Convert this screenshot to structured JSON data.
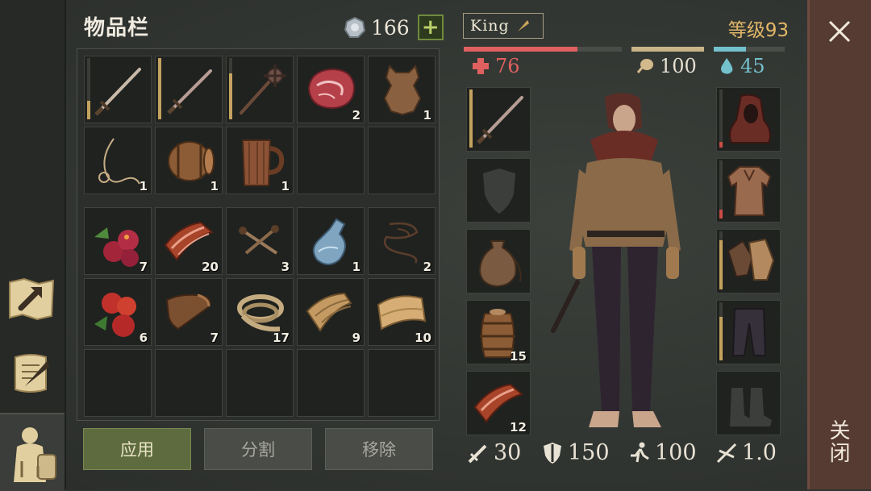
{
  "inventory": {
    "title": "物品栏",
    "coins": "166",
    "add_coins": "+"
  },
  "upper_slots": [
    {
      "icon": "longsword-icon",
      "qty": "",
      "durability": 0.3
    },
    {
      "icon": "sword-icon",
      "qty": "",
      "durability": 1.0
    },
    {
      "icon": "mace-icon",
      "qty": "",
      "durability": 0.75
    },
    {
      "icon": "raw-meat-icon",
      "qty": "2"
    },
    {
      "icon": "leather-hide-icon",
      "qty": "1"
    },
    {
      "icon": "rope-coil-icon",
      "qty": "1"
    },
    {
      "icon": "barrel-icon",
      "qty": "1"
    },
    {
      "icon": "wooden-mug-icon",
      "qty": "1"
    },
    {
      "icon": "",
      "qty": ""
    },
    {
      "icon": "",
      "qty": ""
    }
  ],
  "lower_slots": [
    {
      "icon": "berries-icon",
      "qty": "7"
    },
    {
      "icon": "bacon-icon",
      "qty": "20"
    },
    {
      "icon": "nails-icon",
      "qty": "3"
    },
    {
      "icon": "potion-flask-icon",
      "qty": "1"
    },
    {
      "icon": "thread-icon",
      "qty": "2"
    },
    {
      "icon": "apples-icon",
      "qty": "6"
    },
    {
      "icon": "leather-scraps-icon",
      "qty": "7"
    },
    {
      "icon": "rope-icon",
      "qty": "17"
    },
    {
      "icon": "fabric-scraps-icon",
      "qty": "9"
    },
    {
      "icon": "cloth-roll-icon",
      "qty": "10"
    },
    {
      "icon": "",
      "qty": ""
    },
    {
      "icon": "",
      "qty": ""
    },
    {
      "icon": "",
      "qty": ""
    },
    {
      "icon": "",
      "qty": ""
    },
    {
      "icon": "",
      "qty": ""
    }
  ],
  "actions": {
    "use": "应用",
    "split": "分割",
    "remove": "移除"
  },
  "character": {
    "name": "King",
    "level": "等级93",
    "health": "76",
    "health_fraction": 0.72,
    "hunger": "100",
    "hunger_fraction": 1.0,
    "thirst": "45",
    "thirst_fraction": 0.45
  },
  "equip_left": [
    {
      "icon": "equipped-sword-icon",
      "qty": ""
    },
    {
      "icon": "shield-slot-icon",
      "qty": ""
    },
    {
      "icon": "pouch-icon",
      "qty": ""
    },
    {
      "icon": "barrel-small-icon",
      "qty": "15"
    },
    {
      "icon": "bacon-slot-icon",
      "qty": "12"
    }
  ],
  "equip_right": [
    {
      "icon": "hood-icon"
    },
    {
      "icon": "gambeson-icon"
    },
    {
      "icon": "gloves-icon"
    },
    {
      "icon": "pants-icon"
    },
    {
      "icon": "boots-slot-icon"
    }
  ],
  "combat_stats": {
    "attack": "30",
    "defense": "150",
    "speed": "100",
    "multiplier": "1.0"
  },
  "close": {
    "label": "关闭"
  },
  "colors": {
    "health": "#e06060",
    "hunger": "#c9b488",
    "thirst": "#73c1cc",
    "level": "#e4b769",
    "close_panel": "#563b33"
  }
}
